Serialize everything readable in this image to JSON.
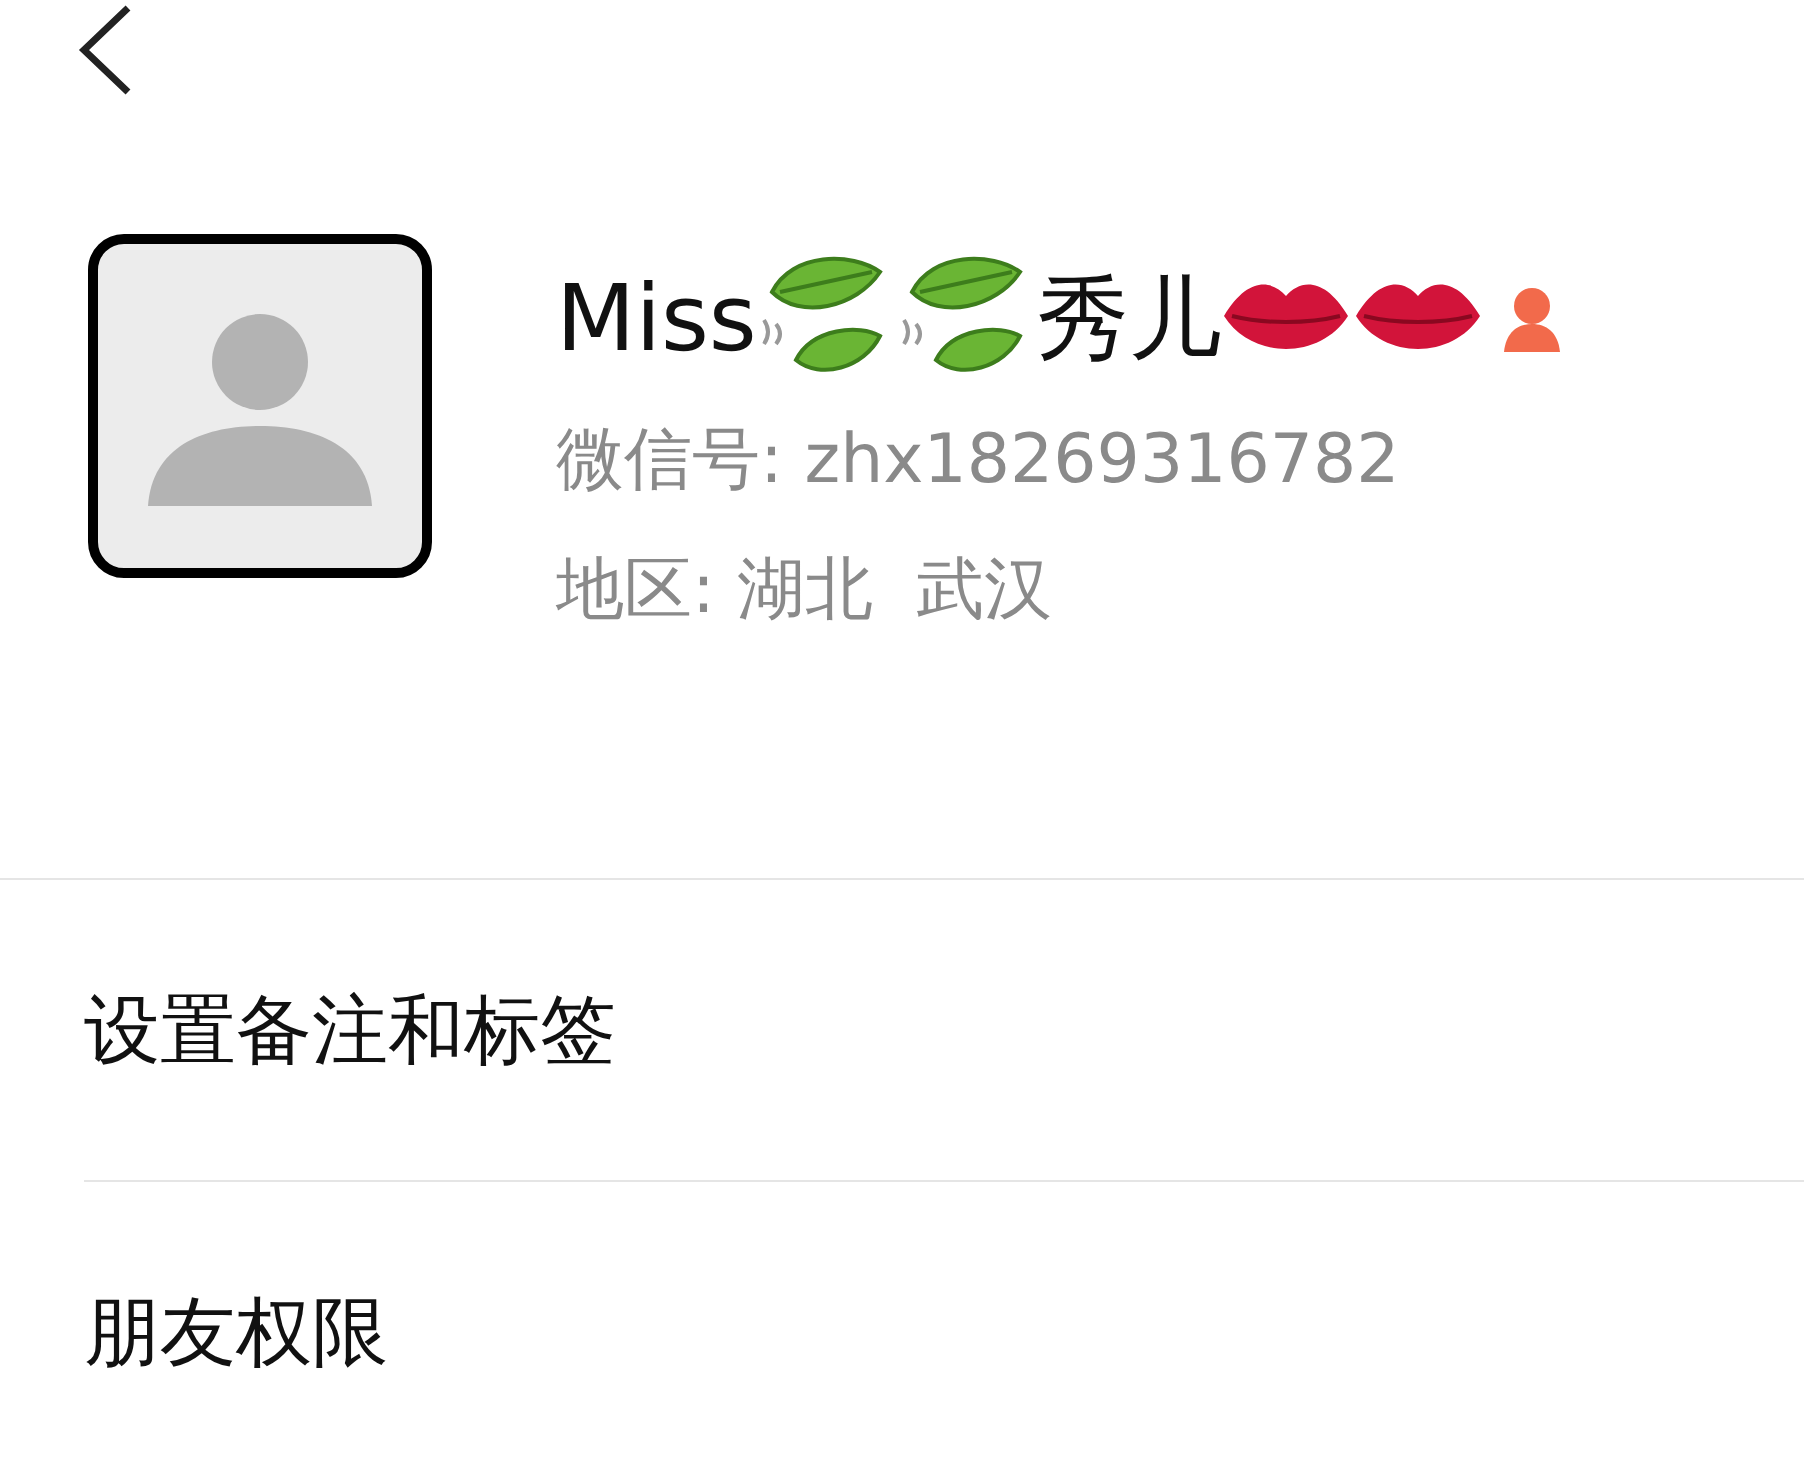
{
  "profile": {
    "name": [
      {
        "kind": "text",
        "text": "Miss"
      },
      {
        "kind": "leaf"
      },
      {
        "kind": "leaf"
      },
      {
        "kind": "text",
        "text": "秀儿"
      },
      {
        "kind": "lips"
      },
      {
        "kind": "lips"
      }
    ],
    "wechat_id": "微信号: zhx18269316782",
    "region": "地区: 湖北  武汉"
  },
  "menu": [
    {
      "label": "设置备注和标签"
    },
    {
      "label": "朋友权限"
    }
  ]
}
